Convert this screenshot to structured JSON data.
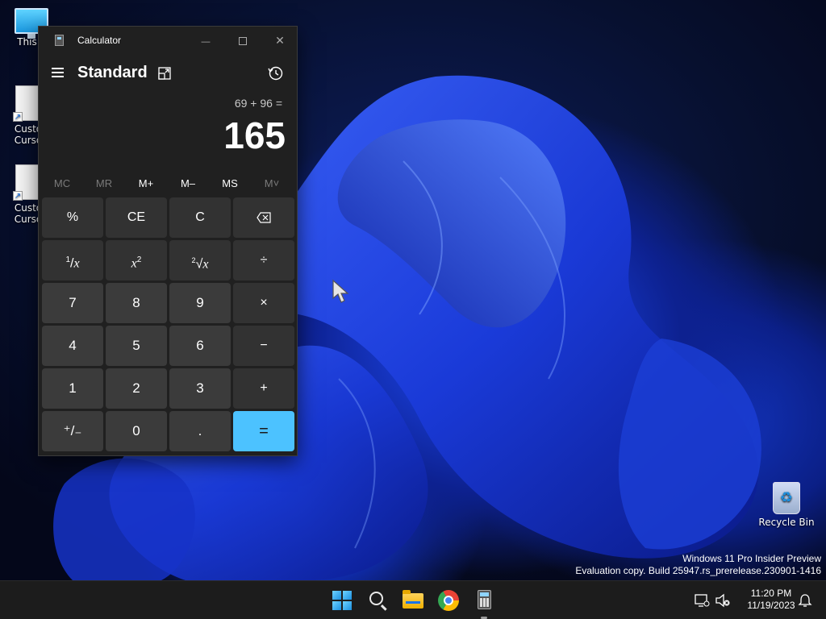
{
  "desktop": {
    "icons": [
      {
        "label": "This P",
        "glyph": "monitor-icon"
      },
      {
        "label": "Custo\nCurso",
        "glyph": "file-shortcut-icon"
      },
      {
        "label": "Custo\nCurso",
        "glyph": "file-shortcut-icon"
      },
      {
        "label": "Recycle Bin",
        "glyph": "recycle-bin-icon"
      }
    ],
    "watermark": {
      "line1": "Windows 11 Pro Insider Preview",
      "line2": "Evaluation copy. Build 25947.rs_prerelease.230901-1416"
    }
  },
  "calculator": {
    "title": "Calculator",
    "mode": "Standard",
    "expression": "69 + 96 =",
    "result": "165",
    "memory_buttons": [
      {
        "label": "MC",
        "enabled": false
      },
      {
        "label": "MR",
        "enabled": false
      },
      {
        "label": "M+",
        "enabled": true
      },
      {
        "label": "M–",
        "enabled": true
      },
      {
        "label": "MS",
        "enabled": true
      },
      {
        "label": "M˅",
        "enabled": false
      }
    ],
    "keys": {
      "percent": "%",
      "ce": "CE",
      "clear": "C",
      "backspace": "⌫",
      "reciprocal_num": "1",
      "reciprocal_den": "x",
      "square_base": "x",
      "square_exp": "2",
      "sqrt_idx": "2",
      "sqrt_rad": "√",
      "sqrt_x": "x",
      "divide": "÷",
      "multiply": "×",
      "minus": "−",
      "plus": "+",
      "seven": "7",
      "eight": "8",
      "nine": "9",
      "four": "4",
      "five": "5",
      "six": "6",
      "one": "1",
      "two": "2",
      "three": "3",
      "negate": "⁺/₋",
      "zero": "0",
      "decimal": ".",
      "equals": "="
    },
    "window_controls": {
      "minimize": "—",
      "close": "✕"
    }
  },
  "taskbar": {
    "apps": [
      "start-icon",
      "search-icon",
      "file-explorer-icon",
      "chrome-icon",
      "calculator-icon"
    ],
    "clock_time": "11:20 PM",
    "clock_date": "11/19/2023"
  },
  "colors": {
    "calc_bg": "#202020",
    "key_bg": "#3b3b3b",
    "equals_accent": "#4cc2ff",
    "taskbar_bg": "#1c1c1c"
  }
}
